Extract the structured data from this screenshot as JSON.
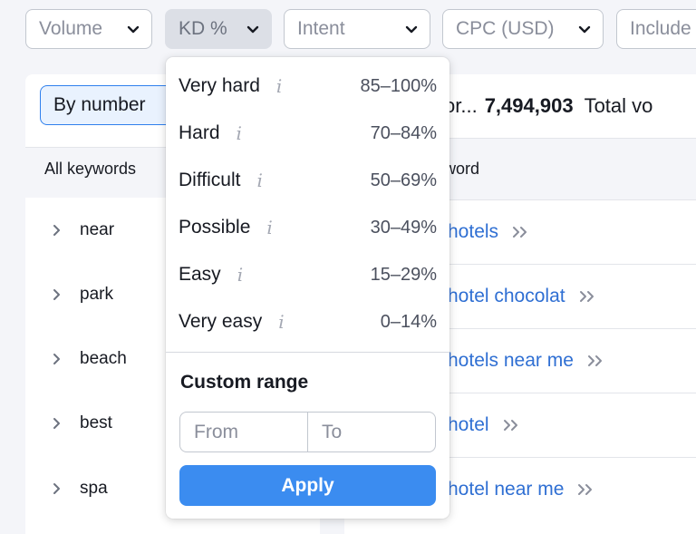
{
  "filters": {
    "volume": "Volume",
    "kd": "KD %",
    "intent": "Intent",
    "cpc": "CPC (USD)",
    "include": "Include"
  },
  "left_panel": {
    "toggle_label": "By number",
    "all_keywords_label": "All keywords",
    "groups": [
      "near",
      "park",
      "beach",
      "best",
      "spa"
    ]
  },
  "right_panel": {
    "truncated_label": "or...",
    "count": "7,494,903",
    "total_volume_label": "Total vo",
    "column_header": "word",
    "keywords": [
      "hotels",
      "hotel chocolat",
      "hotels near me",
      "hotel",
      "hotel near me"
    ]
  },
  "kd_dropdown": {
    "info_glyph": "i",
    "options": [
      {
        "name": "Very hard",
        "range": "85–100%"
      },
      {
        "name": "Hard",
        "range": "70–84%"
      },
      {
        "name": "Difficult",
        "range": "50–69%"
      },
      {
        "name": "Possible",
        "range": "30–49%"
      },
      {
        "name": "Easy",
        "range": "15–29%"
      },
      {
        "name": "Very easy",
        "range": "0–14%"
      }
    ],
    "custom_range_title": "Custom range",
    "from_placeholder": "From",
    "to_placeholder": "To",
    "apply_label": "Apply"
  },
  "colors": {
    "accent": "#3b8cf0",
    "link": "#2f6fd3",
    "background": "#f4f5f9"
  }
}
